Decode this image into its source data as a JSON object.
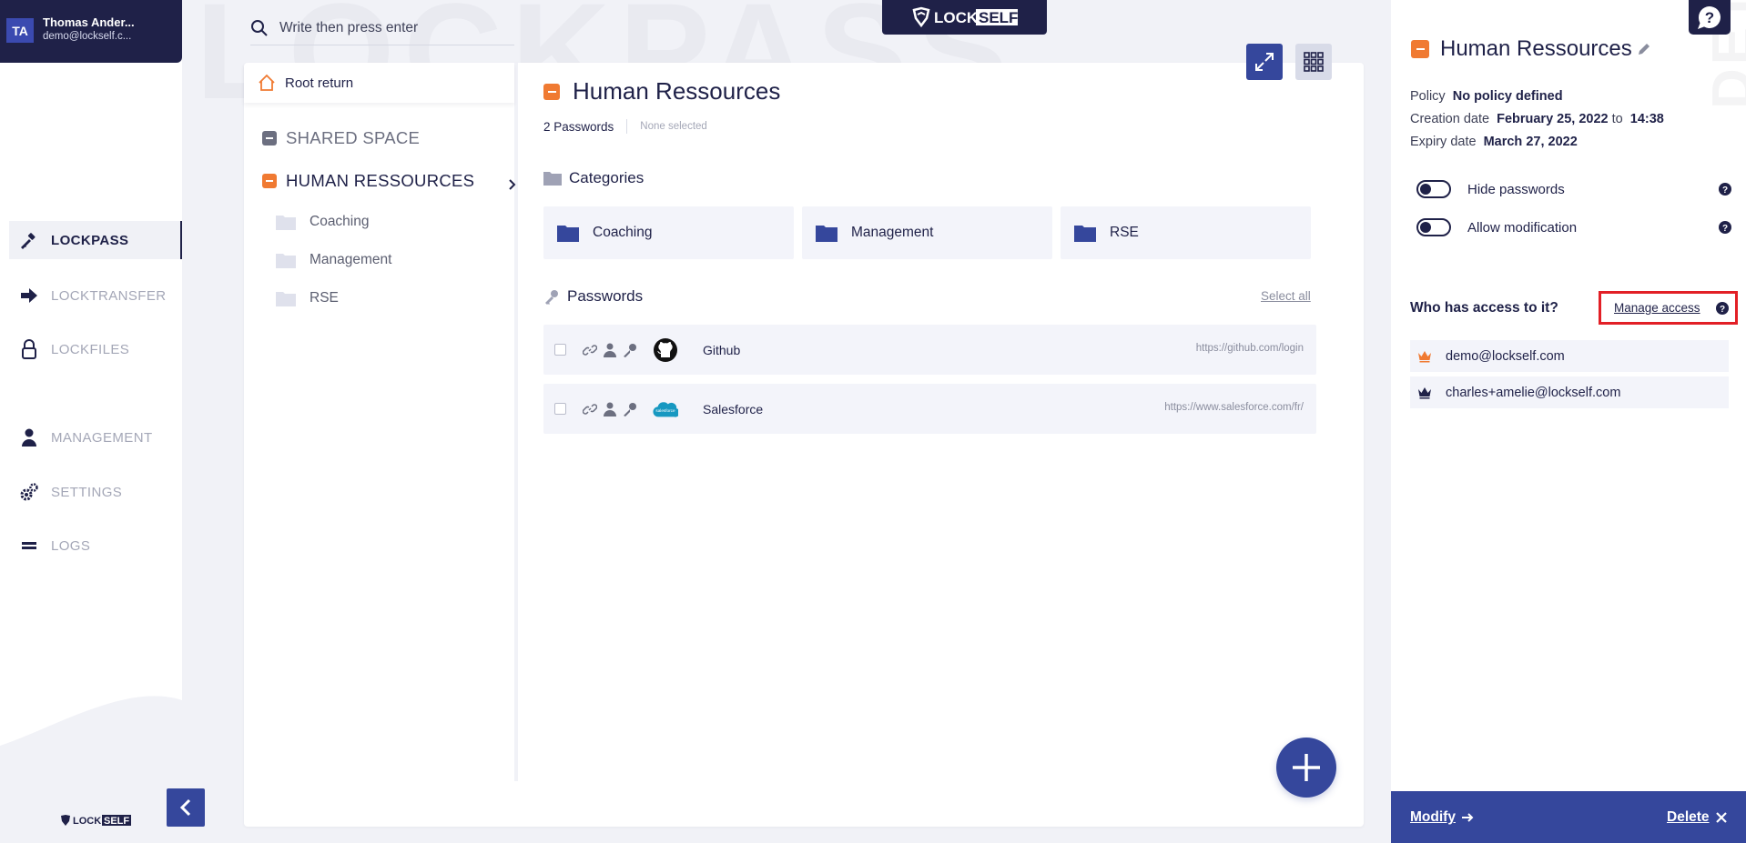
{
  "user": {
    "initials": "TA",
    "name": "Thomas Ander...",
    "email": "demo@lockself.c..."
  },
  "nav": [
    {
      "label": "LOCKPASS",
      "icon": "key-icon",
      "active": true
    },
    {
      "label": "LOCKTRANSFER",
      "icon": "arrow-right-icon",
      "active": false
    },
    {
      "label": "LOCKFILES",
      "icon": "lock-icon",
      "active": false
    },
    {
      "label": "MANAGEMENT",
      "icon": "user-icon",
      "active": false
    },
    {
      "label": "SETTINGS",
      "icon": "gears-icon",
      "active": false
    },
    {
      "label": "LOGS",
      "icon": "list-icon",
      "active": false
    }
  ],
  "brand": {
    "lock": "LOCK",
    "self": "SELF"
  },
  "watermark": "LOCKPASS",
  "search": {
    "placeholder": "Write then press enter"
  },
  "tree": {
    "root_return": "Root return",
    "spaces": [
      {
        "label": "SHARED SPACE"
      },
      {
        "label": "HUMAN RESSOURCES"
      }
    ],
    "folders": [
      "Coaching",
      "Management",
      "RSE"
    ]
  },
  "content": {
    "title": "Human Ressources",
    "password_count": "2 Passwords",
    "selection_status": "None selected",
    "categories_label": "Categories",
    "categories": [
      "Coaching",
      "Management",
      "RSE"
    ],
    "passwords_label": "Passwords",
    "select_all": "Select all",
    "passwords": [
      {
        "name": "Github",
        "url": "https://github.com/login",
        "logo": "github-logo-icon"
      },
      {
        "name": "Salesforce",
        "url": "https://www.salesforce.com/fr/",
        "logo": "salesforce-logo-icon",
        "logo_text": "salesforce"
      }
    ]
  },
  "details": {
    "vertical_label": "DETAILS",
    "title": "Human Ressources",
    "policy_label": "Policy",
    "policy_value": "No policy defined",
    "creation_label": "Creation date",
    "creation_date": "February 25, 2022",
    "creation_to": "to",
    "creation_time": "14:38",
    "expiry_label": "Expiry date",
    "expiry_value": "March 27, 2022",
    "toggles": [
      {
        "label": "Hide passwords"
      },
      {
        "label": "Allow modification"
      }
    ],
    "access_label": "Who has access to it?",
    "manage_access": "Manage access",
    "access": [
      {
        "email": "demo@lockself.com",
        "role_color": "#f07a32"
      },
      {
        "email": "charles+amelie@lockself.com",
        "role_color": "#1f2148"
      }
    ],
    "modify": "Modify",
    "delete": "Delete"
  },
  "colors": {
    "navy": "#1f2148",
    "accent": "#35479c",
    "orange": "#f07a32",
    "highlight": "#e21f26"
  }
}
